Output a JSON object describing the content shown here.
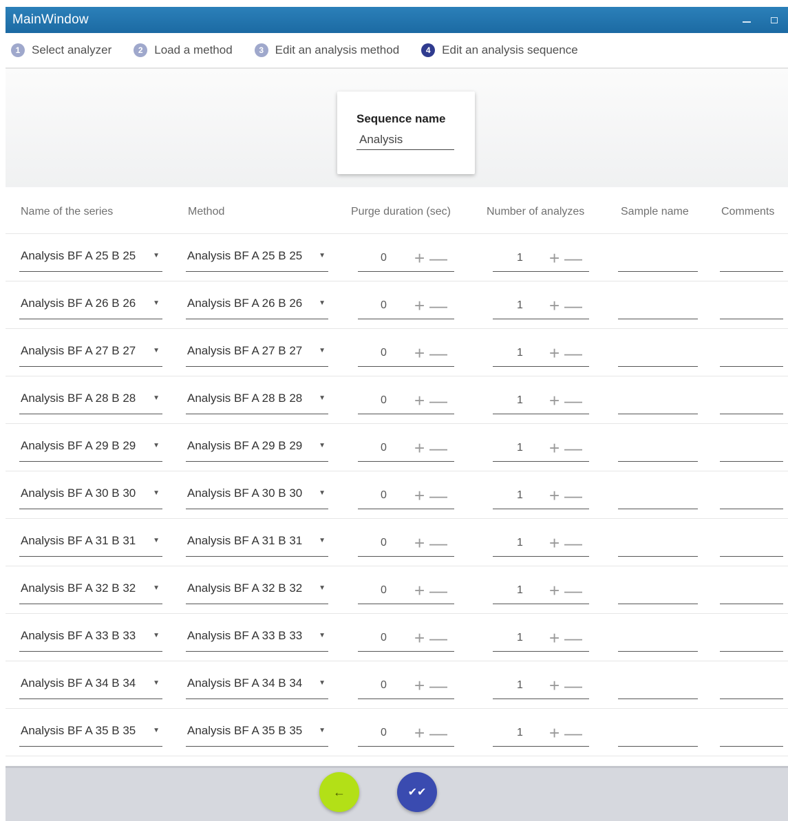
{
  "window": {
    "title": "MainWindow",
    "minimize_icon": "minimize-icon",
    "restore_icon": "restore-icon"
  },
  "steps": [
    {
      "number": "1",
      "label": "Select analyzer",
      "active": false
    },
    {
      "number": "2",
      "label": "Load a method",
      "active": false
    },
    {
      "number": "3",
      "label": "Edit an analysis method",
      "active": false
    },
    {
      "number": "4",
      "label": "Edit an analysis sequence",
      "active": true
    }
  ],
  "sequence": {
    "label": "Sequence name",
    "value": "Analysis"
  },
  "table": {
    "headers": {
      "series": "Name of the series",
      "method": "Method",
      "purge": "Purge duration (sec)",
      "count": "Number of analyzes",
      "sample": "Sample name",
      "comments": "Comments"
    },
    "rows": [
      {
        "series": "Analysis BF A 25 B 25",
        "method": "Analysis BF A 25 B 25",
        "purge": "0",
        "count": "1",
        "sample": "",
        "comments": ""
      },
      {
        "series": "Analysis BF A 26 B 26",
        "method": "Analysis BF A 26 B 26",
        "purge": "0",
        "count": "1",
        "sample": "",
        "comments": ""
      },
      {
        "series": "Analysis BF A 27 B 27",
        "method": "Analysis BF A 27 B 27",
        "purge": "0",
        "count": "1",
        "sample": "",
        "comments": ""
      },
      {
        "series": "Analysis BF A 28 B 28",
        "method": "Analysis BF A 28 B 28",
        "purge": "0",
        "count": "1",
        "sample": "",
        "comments": ""
      },
      {
        "series": "Analysis BF A 29 B 29",
        "method": "Analysis BF A 29 B 29",
        "purge": "0",
        "count": "1",
        "sample": "",
        "comments": ""
      },
      {
        "series": "Analysis BF A 30 B 30",
        "method": "Analysis BF A 30 B 30",
        "purge": "0",
        "count": "1",
        "sample": "",
        "comments": ""
      },
      {
        "series": "Analysis BF A 31 B 31",
        "method": "Analysis BF A 31 B 31",
        "purge": "0",
        "count": "1",
        "sample": "",
        "comments": ""
      },
      {
        "series": "Analysis BF A 32 B 32",
        "method": "Analysis BF A 32 B 32",
        "purge": "0",
        "count": "1",
        "sample": "",
        "comments": ""
      },
      {
        "series": "Analysis BF A 33 B 33",
        "method": "Analysis BF A 33 B 33",
        "purge": "0",
        "count": "1",
        "sample": "",
        "comments": ""
      },
      {
        "series": "Analysis BF A 34 B 34",
        "method": "Analysis BF A 34 B 34",
        "purge": "0",
        "count": "1",
        "sample": "",
        "comments": ""
      },
      {
        "series": "Analysis BF A 35 B 35",
        "method": "Analysis BF A 35 B 35",
        "purge": "0",
        "count": "1",
        "sample": "",
        "comments": ""
      }
    ],
    "increment_symbol": "+",
    "decrement_symbol": "—",
    "dropdown_symbol": "▼"
  },
  "footer": {
    "back_symbol": "←",
    "back_icon": "arrow-left-icon",
    "validate_symbol": "✔✔",
    "validate_icon": "double-check-icon"
  },
  "colors": {
    "titlebar": "#1c6aa3",
    "step_active": "#2f3b8f",
    "step_inactive": "#9fa8cc",
    "back_button": "#b3e017",
    "validate_button": "#3a4bb0"
  }
}
